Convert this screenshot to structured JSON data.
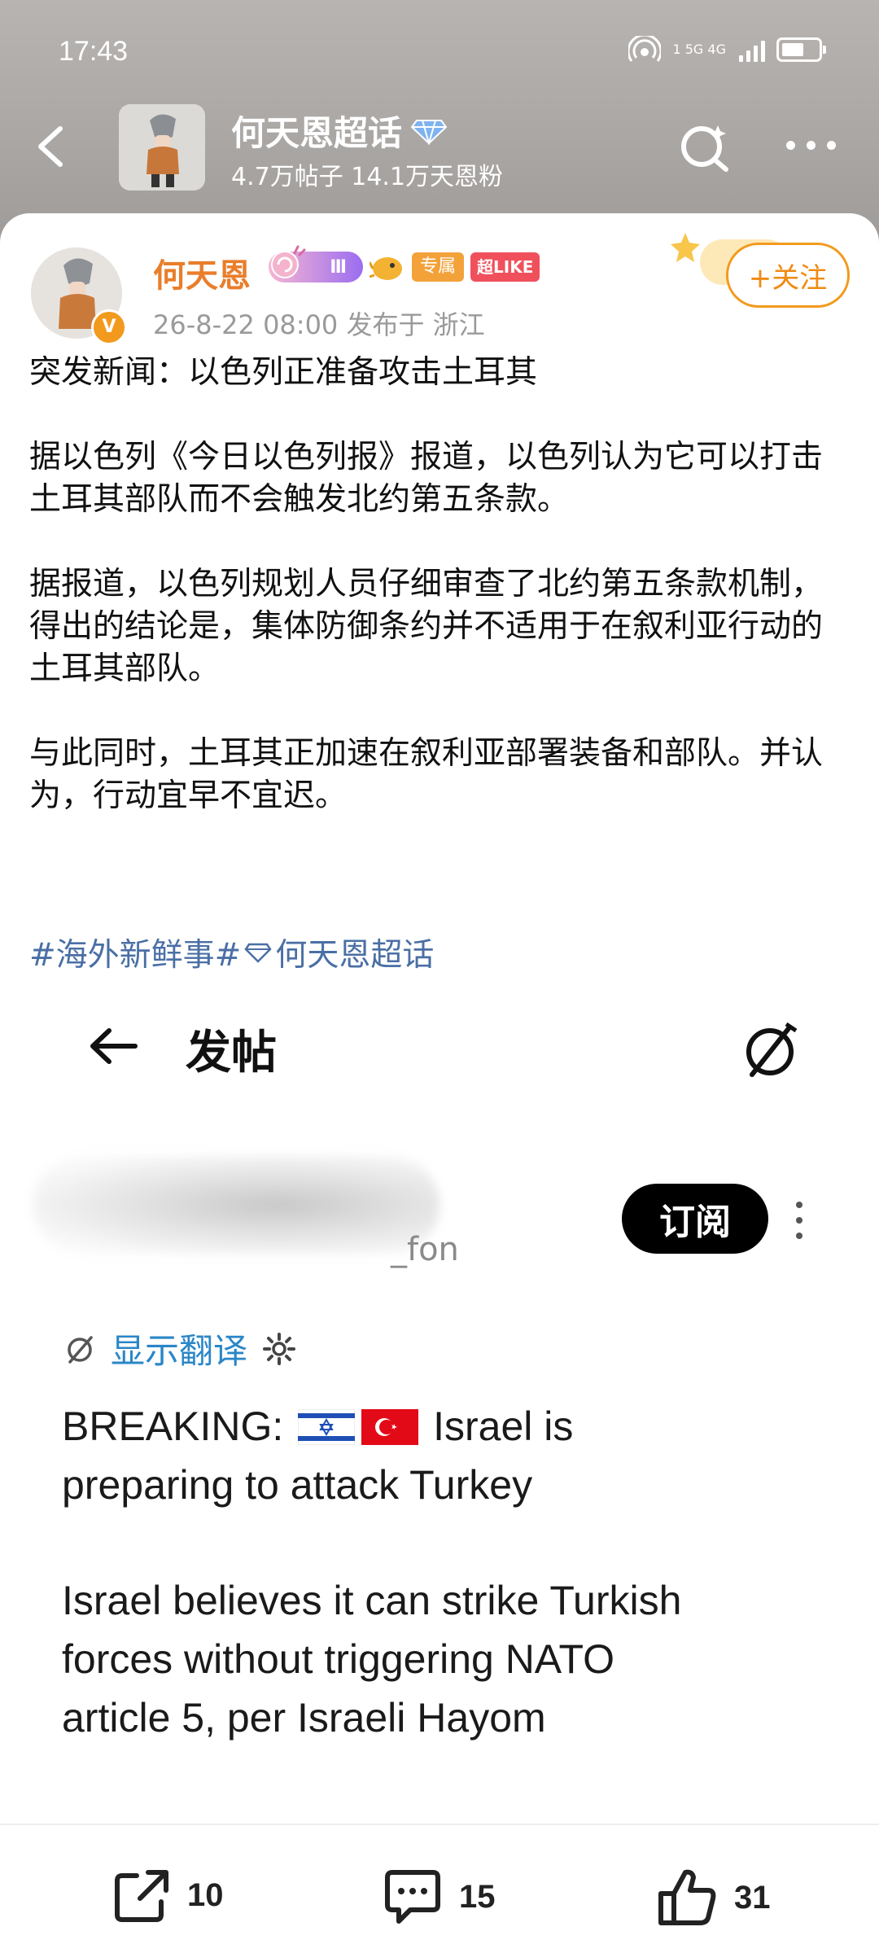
{
  "status_bar": {
    "time": "17:43",
    "network": "1 5G 4G"
  },
  "header": {
    "title": "何天恩超话",
    "subtitle": "4.7万帖子 14.1万天恩粉"
  },
  "post": {
    "author": "何天恩",
    "level": "Ⅲ",
    "tag_exclusive": "专属",
    "tag_like": "超LIKE",
    "meta": "26-8-22 08:00  发布于 浙江",
    "follow_label": "+关注",
    "paragraphs": [
      "突发新闻：以色列正准备攻击土耳其",
      "据以色列《今日以色列报》报道，以色列认为它可以打击土耳其部队而不会触发北约第五条款。",
      "据报道，以色列规划人员仔细审查了北约第五条款机制，得出的结论是，集体防御条约并不适用于在叙利亚行动的土耳其部队。",
      "与此同时，土耳其正加速在叙利亚部署装备和部队。并认为，行动宜早不宜迟。"
    ],
    "tag1": "#海外新鲜事#",
    "tag2": "何天恩超话"
  },
  "embedded": {
    "title": "发帖",
    "handle_suffix": "_fon",
    "subscribe_label": "订阅",
    "translate_label": "显示翻译",
    "breaking_prefix": "BREAKING:",
    "breaking_rest": "Israel is",
    "breaking_line2": "preparing to attack Turkey",
    "para_line1": "Israel believes it can strike Turkish",
    "para_line2": "forces without triggering NATO",
    "para_line3": "article 5, per Israeli Hayom"
  },
  "actions": {
    "share_count": "10",
    "comment_count": "15",
    "like_count": "31"
  },
  "colors": {
    "author": "#e97e2b",
    "follow": "#f29a1d",
    "hashtag": "#4a6fa5",
    "translate_link": "#2a86c7"
  }
}
